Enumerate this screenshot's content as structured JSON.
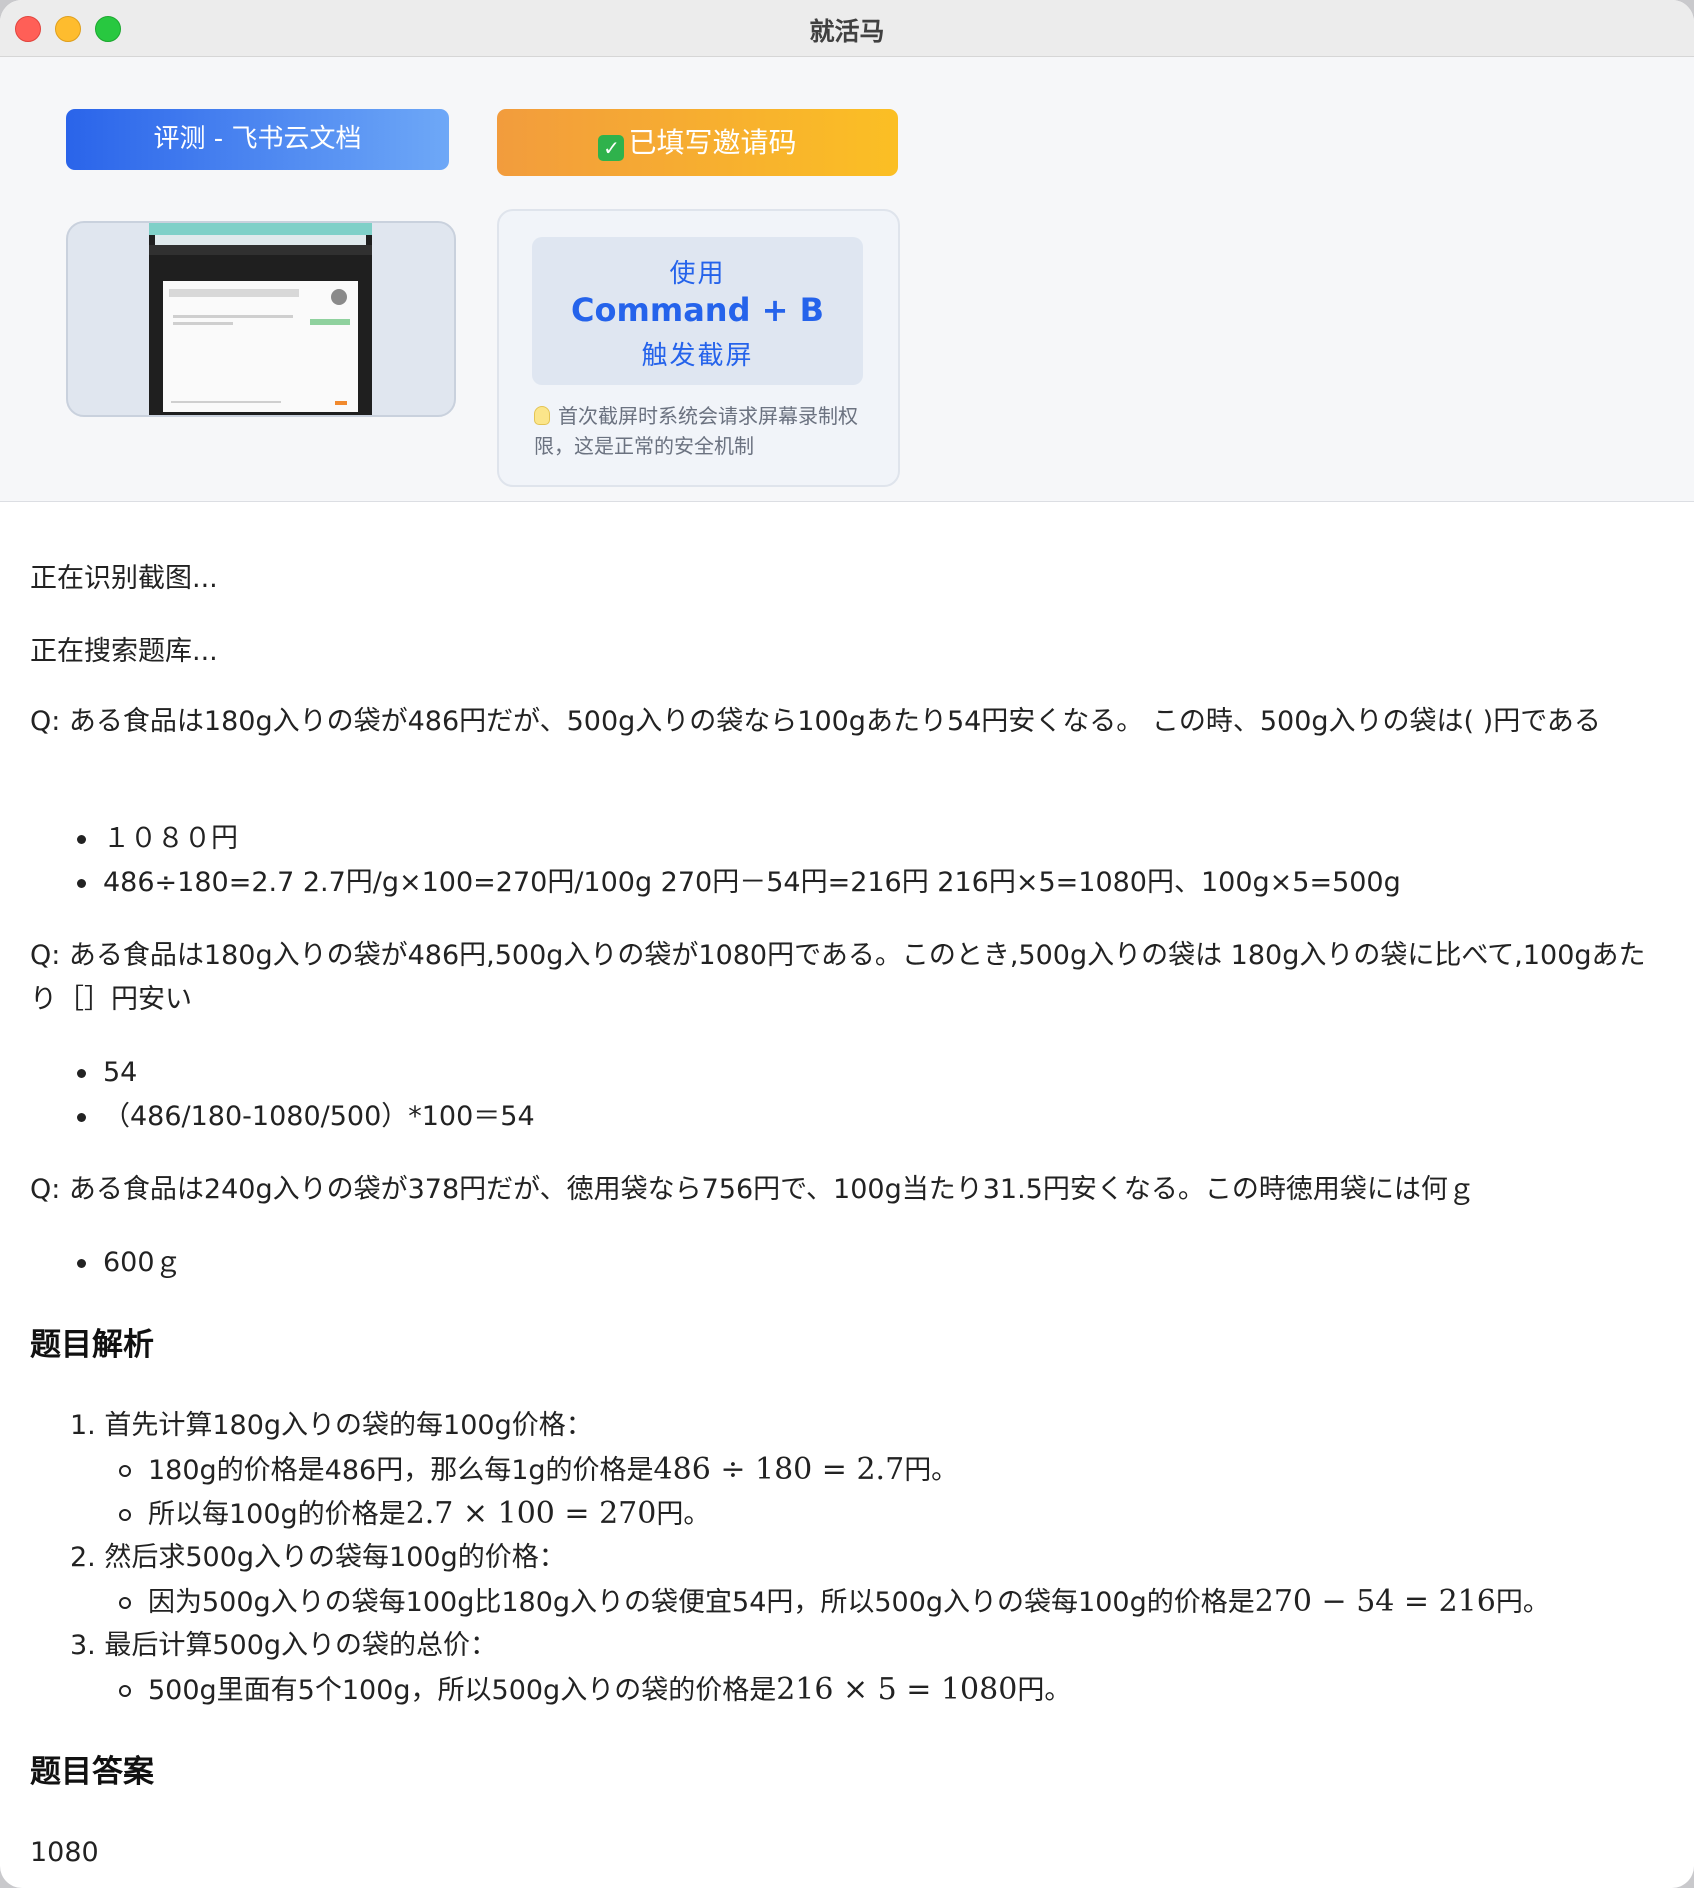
{
  "window": {
    "title": "就活马"
  },
  "top": {
    "review_button": "评测 - 飞书云文档",
    "invite_button": "已填写邀请码",
    "shortcut": {
      "line1": "使用",
      "line2": "Command + B",
      "line3": "触发截屏"
    },
    "tip": "首次截屏时系统会请求屏幕录制权限，这是正常的安全机制"
  },
  "status": [
    "正在识别截图...",
    "正在搜索题库..."
  ],
  "results": [
    {
      "question": "Q: ある食品は180g入りの袋が486円だが、500g入りの袋なら100gあたり54円安くなる。 この時、500g入りの袋は( )円である",
      "answers": [
        "１０８０円",
        "486÷180=2.7 2.7円/g×100=270円/100g 270円－54円=216円 216円×5=1080円、100g×5=500g"
      ]
    },
    {
      "question": "Q: ある食品は180g入りの袋が486円,500g入りの袋が1080円である。このとき,500g入りの袋は 180g入りの袋に比べて,100gあたり［］円安い",
      "answers": [
        "54",
        "（486/180-1080/500）*100＝54"
      ]
    },
    {
      "question": "Q: ある食品は240g入りの袋が378円だが、徳用袋なら756円で、100g当たり31.5円安くなる。この時徳用袋には何ｇ",
      "answers": [
        "600ｇ"
      ]
    }
  ],
  "analysis": {
    "heading": "题目解析",
    "steps": [
      {
        "num": "1.",
        "text": "首先计算180g入りの袋的每100g价格：",
        "subs": [
          {
            "pre": "180g的价格是486円，那么每1g的价格是",
            "math": "486 ÷ 180 = 2.7",
            "post": "円。"
          },
          {
            "pre": "所以每100g的价格是",
            "math": "2.7 × 100 = 270",
            "post": "円。"
          }
        ]
      },
      {
        "num": "2.",
        "text": "然后求500g入りの袋每100g的价格：",
        "subs": [
          {
            "pre": "因为500g入りの袋每100g比180g入りの袋便宜54円，所以500g入りの袋每100g的价格是",
            "math": "270 − 54 = 216",
            "post": "円。"
          }
        ]
      },
      {
        "num": "3.",
        "text": "最后计算500g入りの袋的总价：",
        "subs": [
          {
            "pre": "500g里面有5个100g，所以500g入りの袋的价格是",
            "math": "216 × 5 = 1080",
            "post": "円。"
          }
        ]
      }
    ]
  },
  "answer": {
    "heading": "题目答案",
    "value": "1080"
  },
  "colors": {
    "accent_blue": "#2563eb",
    "invite_orange": "#f29c3d"
  }
}
